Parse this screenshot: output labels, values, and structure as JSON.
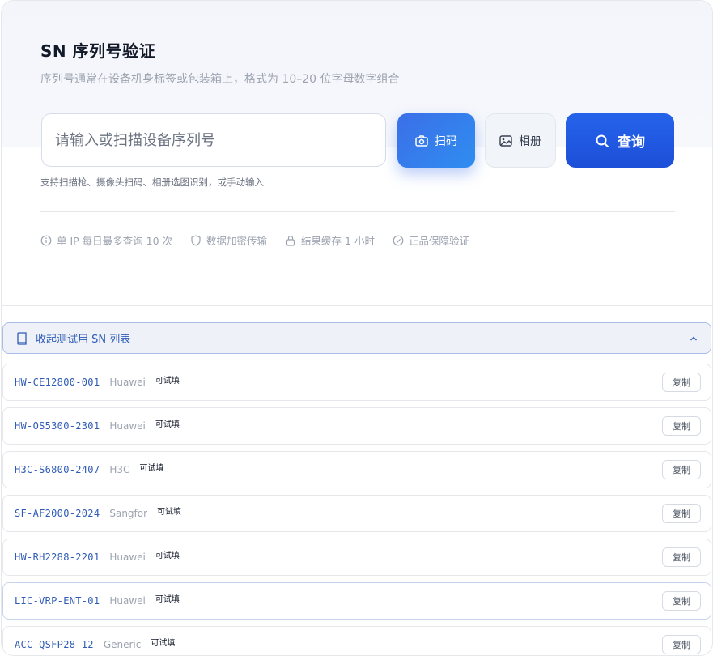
{
  "header": {
    "title": "SN 序列号验证",
    "subtitle": "序列号通常在设备机身标签或包装箱上，格式为 10–20 位字母数字组合"
  },
  "search": {
    "placeholder": "请输入或扫描设备序列号",
    "scan_label": "扫码",
    "album_label": "相册",
    "query_label": "查询",
    "hint": "支持扫描枪、摄像头扫码、相册选图识别，或手动输入"
  },
  "features": [
    {
      "icon": "info-icon",
      "label": "单 IP 每日最多查询 10 次"
    },
    {
      "icon": "shield-icon",
      "label": "数据加密传输"
    },
    {
      "icon": "lock-icon",
      "label": "结果缓存 1 小时"
    },
    {
      "icon": "check-circle-icon",
      "label": "正品保障验证"
    }
  ],
  "test_list": {
    "toggle_label": "收起测试用 SN 列表",
    "items": [
      {
        "sn": "HW-CE12800-001",
        "vendor": "Huawei",
        "tag": "可试填",
        "copy": "复制"
      },
      {
        "sn": "HW-OS5300-2301",
        "vendor": "Huawei",
        "tag": "可试填",
        "copy": "复制"
      },
      {
        "sn": "H3C-S6800-2407",
        "vendor": "H3C",
        "tag": "可试填",
        "copy": "复制"
      },
      {
        "sn": "SF-AF2000-2024",
        "vendor": "Sangfor",
        "tag": "可试填",
        "copy": "复制"
      },
      {
        "sn": "HW-RH2288-2201",
        "vendor": "Huawei",
        "tag": "可试填",
        "copy": "复制"
      },
      {
        "sn": "LIC-VRP-ENT-01",
        "vendor": "Huawei",
        "tag": "可试填",
        "copy": "复制"
      },
      {
        "sn": "ACC-QSFP28-12",
        "vendor": "Generic",
        "tag": "可试填",
        "copy": "复制"
      }
    ]
  },
  "colors": {
    "accent": "#2563eb",
    "link": "#2f5bb7",
    "muted": "#9ca3af"
  }
}
